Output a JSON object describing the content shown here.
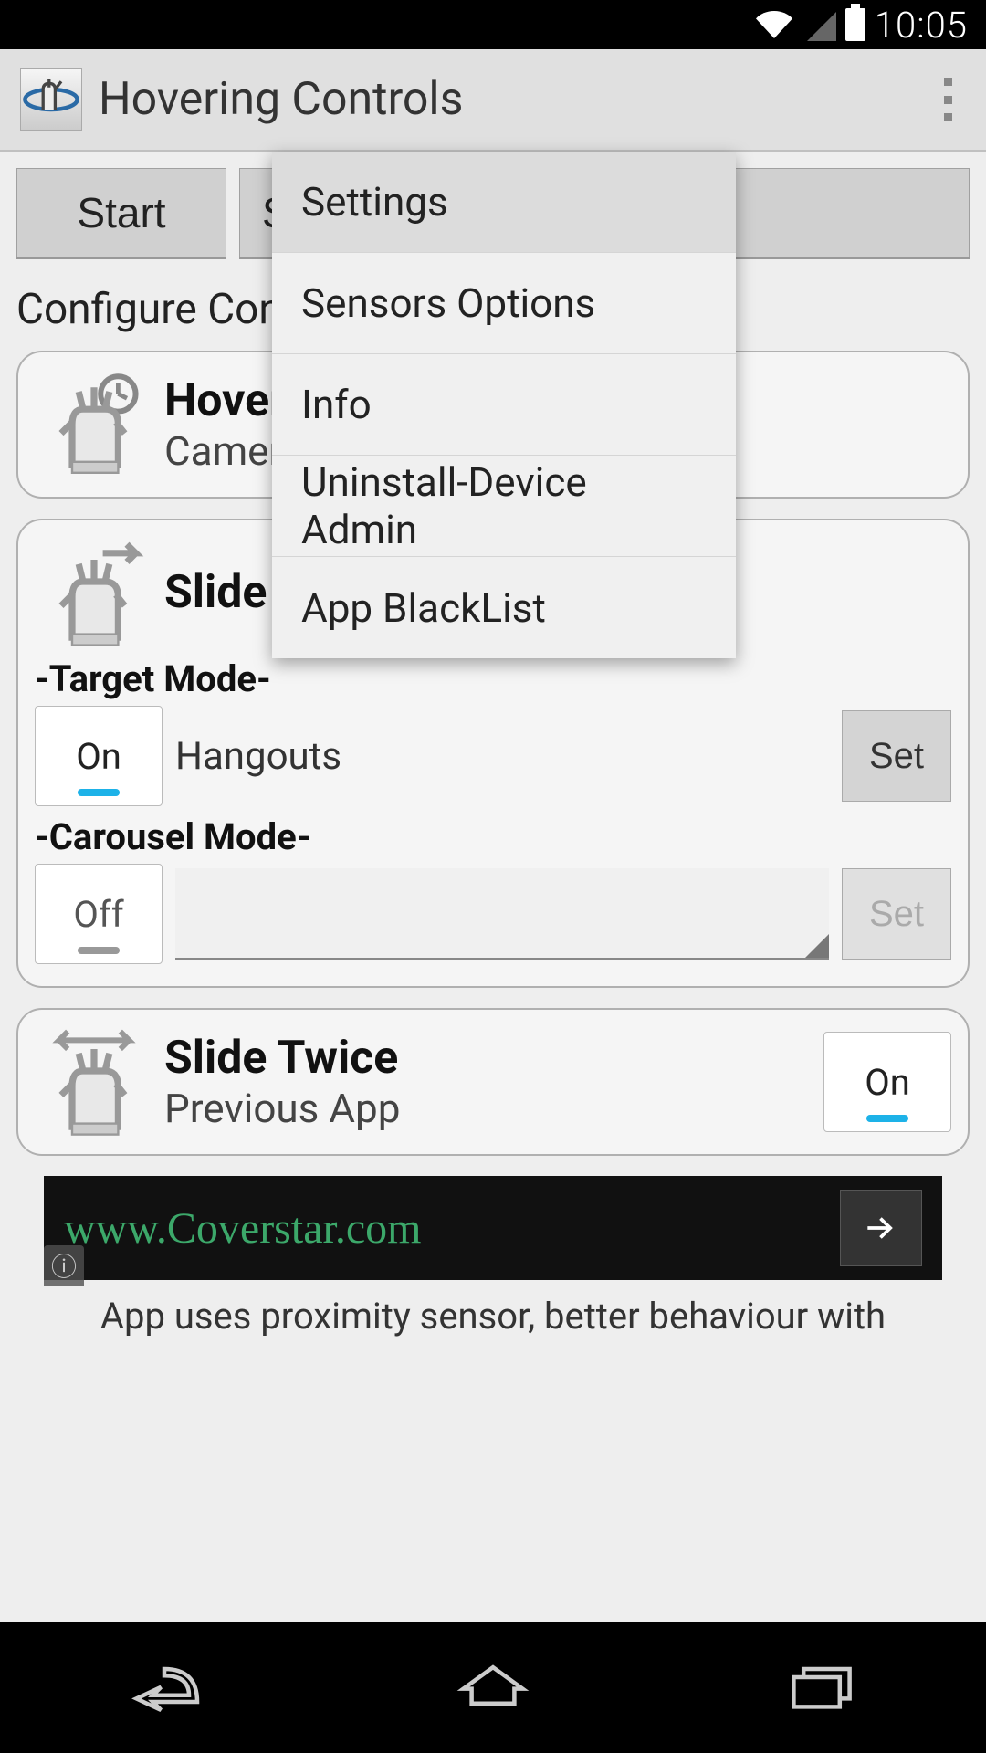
{
  "status": {
    "time": "10:05"
  },
  "header": {
    "title": "Hovering Controls"
  },
  "buttons": {
    "start": "Start",
    "stop_partial": "S"
  },
  "section_label": "Configure Controls",
  "cards": {
    "hover": {
      "title": "Hover H",
      "subtitle": "Camera"
    },
    "slide_once": {
      "title": "Slide Onc",
      "target_mode_label": "-Target Mode-",
      "target_value": "Hangouts",
      "target_toggle": "On",
      "target_set": "Set",
      "carousel_mode_label": "-Carousel Mode-",
      "carousel_toggle": "Off",
      "carousel_set": "Set"
    },
    "slide_twice": {
      "title": "Slide Twice",
      "subtitle": "Previous App",
      "toggle": "On"
    }
  },
  "ad": {
    "url": "www.Coverstar.com"
  },
  "footer": "App uses proximity sensor, better behaviour with",
  "menu": {
    "items": [
      "Settings",
      "Sensors Options",
      "Info",
      "Uninstall-Device Admin",
      "App BlackList"
    ]
  }
}
